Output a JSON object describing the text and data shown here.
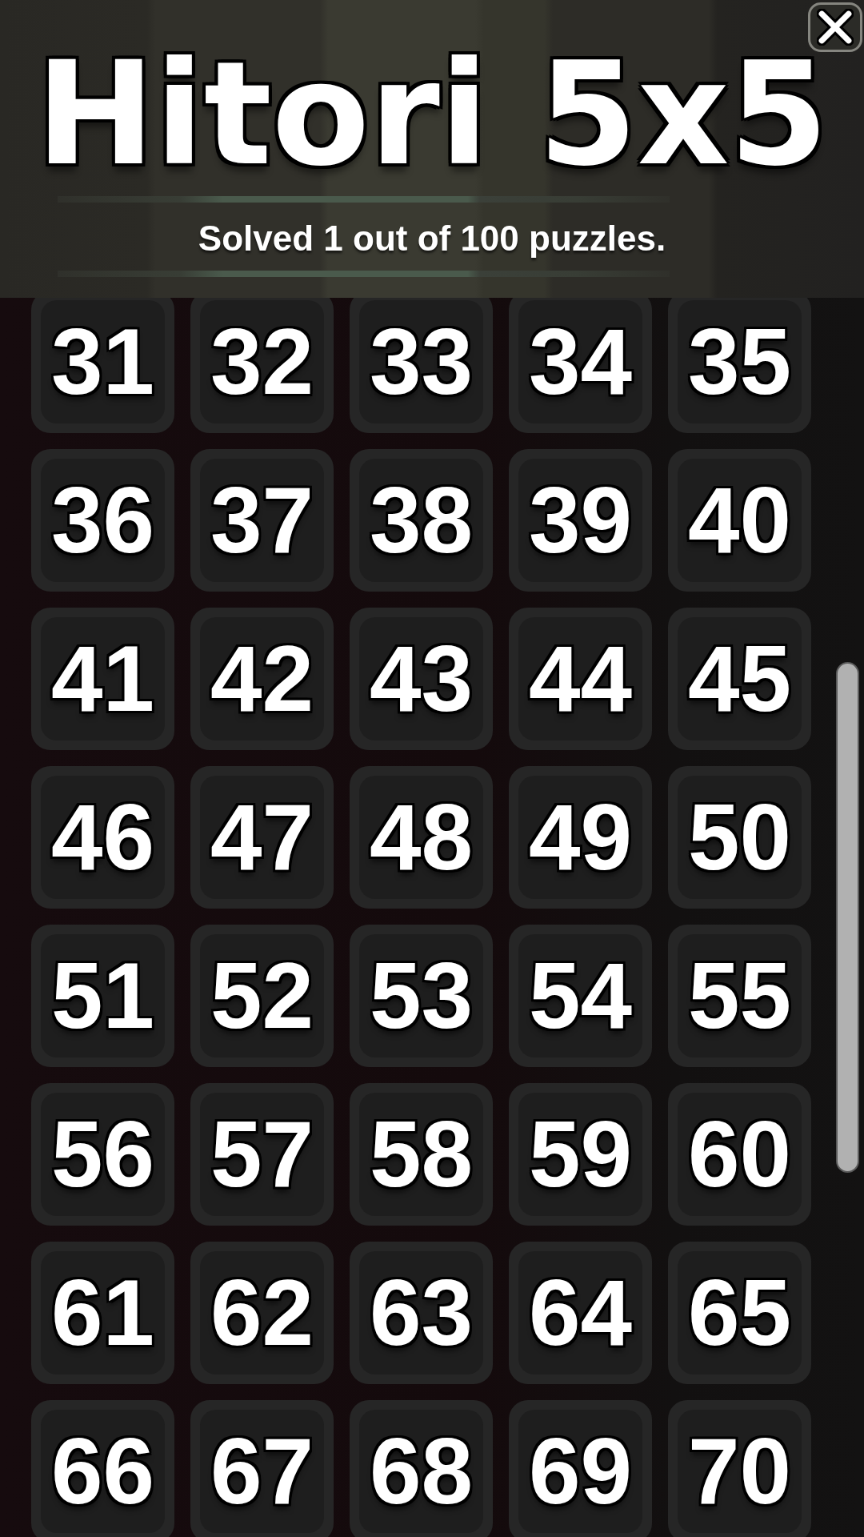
{
  "header": {
    "title": "Hitori 5x5",
    "subtitle": "Solved 1 out of 100 puzzles."
  },
  "puzzles": [
    "31",
    "32",
    "33",
    "34",
    "35",
    "36",
    "37",
    "38",
    "39",
    "40",
    "41",
    "42",
    "43",
    "44",
    "45",
    "46",
    "47",
    "48",
    "49",
    "50",
    "51",
    "52",
    "53",
    "54",
    "55",
    "56",
    "57",
    "58",
    "59",
    "60",
    "61",
    "62",
    "63",
    "64",
    "65",
    "66",
    "67",
    "68",
    "69",
    "70"
  ]
}
